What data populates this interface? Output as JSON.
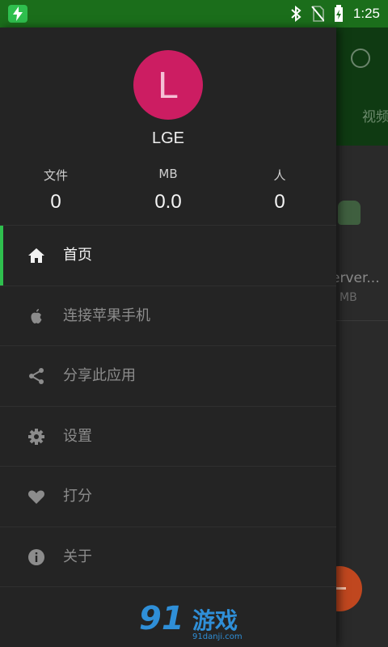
{
  "status_bar": {
    "time": "1:25",
    "icons": [
      "charging-app-icon",
      "bluetooth-icon",
      "no-sim-icon",
      "battery-charging-icon"
    ]
  },
  "background_app": {
    "tab_partial": "视频",
    "list_item_name": "erver...",
    "list_item_size": "MB"
  },
  "drawer": {
    "avatar_letter": "L",
    "username": "LGE",
    "stats": [
      {
        "label": "文件",
        "value": "0"
      },
      {
        "label": "MB",
        "value": "0.0"
      },
      {
        "label": "人",
        "value": "0"
      }
    ],
    "menu": [
      {
        "label": "首页",
        "icon": "home-icon",
        "active": true
      },
      {
        "label": "连接苹果手机",
        "icon": "apple-icon",
        "active": false
      },
      {
        "label": "分享此应用",
        "icon": "share-icon",
        "active": false
      },
      {
        "label": "设置",
        "icon": "gear-icon",
        "active": false
      },
      {
        "label": "打分",
        "icon": "heart-icon",
        "active": false
      },
      {
        "label": "关于",
        "icon": "info-icon",
        "active": false
      }
    ]
  },
  "watermark": {
    "logo": "91",
    "text": "游戏",
    "url": "91danji.com"
  },
  "colors": {
    "status_bar": "#1b6e1b",
    "accent": "#2fbf4e",
    "avatar": "#cc1d62",
    "fab": "#c0471f"
  }
}
